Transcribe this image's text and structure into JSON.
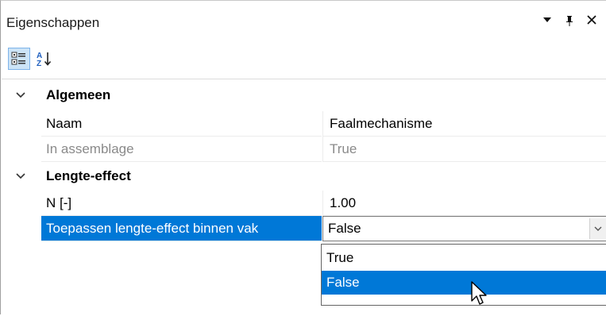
{
  "panel": {
    "title": "Eigenschappen",
    "menu_icon": "dropdown-arrow-icon",
    "pin_icon": "pin-icon",
    "close_icon": "close-icon"
  },
  "toolbar": {
    "categorized_icon": "categorized-view-icon",
    "alphabetical_icon": "sort-alphabetical-icon"
  },
  "grid": {
    "categories": [
      {
        "label": "Algemeen",
        "properties": [
          {
            "name": "Naam",
            "value": "Faalmechanisme",
            "readonly": false
          },
          {
            "name": "In assemblage",
            "value": "True",
            "readonly": true
          }
        ]
      },
      {
        "label": "Lengte-effect",
        "properties": [
          {
            "name": "N [-]",
            "value": "1.00",
            "readonly": false
          },
          {
            "name": "Toepassen lengte-effect binnen vak",
            "value": "False",
            "selected": true,
            "editor": "dropdown"
          }
        ]
      }
    ]
  },
  "dropdown": {
    "options": [
      "True",
      "False"
    ],
    "highlighted": "False"
  },
  "colors": {
    "selection": "#0078d7",
    "readonly_text": "#8a8a8a"
  }
}
